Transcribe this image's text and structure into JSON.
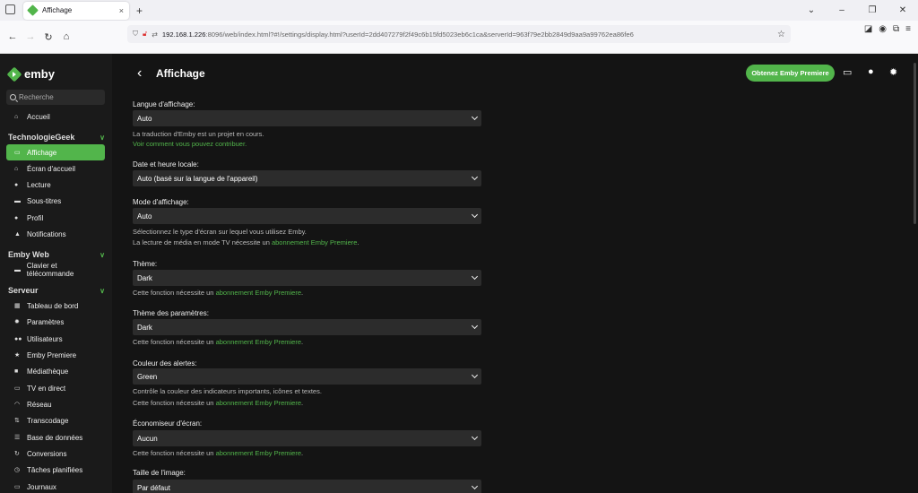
{
  "browser": {
    "tab_title": "Affichage",
    "tab_close": "×",
    "new_tab": "+",
    "url_host": "192.168.1.226",
    "url_rest": ":8096/web/index.html?#!/settings/display.html?userId=2dd407279f2f49c6b15fd5023eb6c1ca&serverId=963f79e2bb2849d9aa9a99762ea86fe6",
    "win_minimize": "–",
    "win_restore": "❐",
    "win_close": "✕"
  },
  "colors": {
    "accent": "#52b54b",
    "sidebar_bg": "#1a1a1a",
    "main_bg": "#141414",
    "select_bg": "#2c2c2c"
  },
  "app": {
    "logo": "emby",
    "search_placeholder": "Recherche",
    "home": "Accueil",
    "sections": [
      {
        "title": "TechnologieGeek",
        "items": [
          "Affichage",
          "Écran d'accueil",
          "Lecture",
          "Sous-titres",
          "Profil",
          "Notifications"
        ]
      },
      {
        "title": "Emby Web",
        "items": [
          "Clavier et télécommande"
        ]
      },
      {
        "title": "Serveur",
        "items": [
          "Tableau de bord",
          "Paramètres",
          "Utilisateurs",
          "Emby Premiere",
          "Médiathèque",
          "TV en direct",
          "Réseau",
          "Transcodage",
          "Base de données",
          "Conversions",
          "Tâches planifiées",
          "Journaux"
        ]
      }
    ],
    "page_title": "Affichage",
    "premiere_button": "Obtenez Emby Premiere"
  },
  "settings": {
    "language": {
      "label": "Langue d'affichage:",
      "value": "Auto",
      "help": "La traduction d'Emby est un projet en cours.",
      "link": "Voir comment vous pouvez contribuer."
    },
    "datetime": {
      "label": "Date et heure locale:",
      "value": "Auto (basé sur la langue de l'appareil)"
    },
    "mode": {
      "label": "Mode d'affichage:",
      "value": "Auto",
      "help1": "Sélectionnez le type d'écran sur lequel vous utilisez Emby.",
      "help2_prefix": "La lecture de média en mode TV nécessite un ",
      "help2_link": "abonnement Emby Premiere",
      "help2_suffix": "."
    },
    "theme": {
      "label": "Thème:",
      "value": "Dark"
    },
    "settings_theme": {
      "label": "Thème des paramètres:",
      "value": "Dark"
    },
    "alert_color": {
      "label": "Couleur des alertes:",
      "value": "Green",
      "help": "Contrôle la couleur des indicateurs importants, icônes et textes."
    },
    "screensaver": {
      "label": "Économiseur d'écran:",
      "value": "Aucun"
    },
    "image_size": {
      "label": "Taille de l'image:",
      "value": "Par défaut"
    },
    "premium_prefix": "Cette fonction nécessite un ",
    "premium_link": "abonnement Emby Premiere",
    "premium_suffix": "."
  }
}
